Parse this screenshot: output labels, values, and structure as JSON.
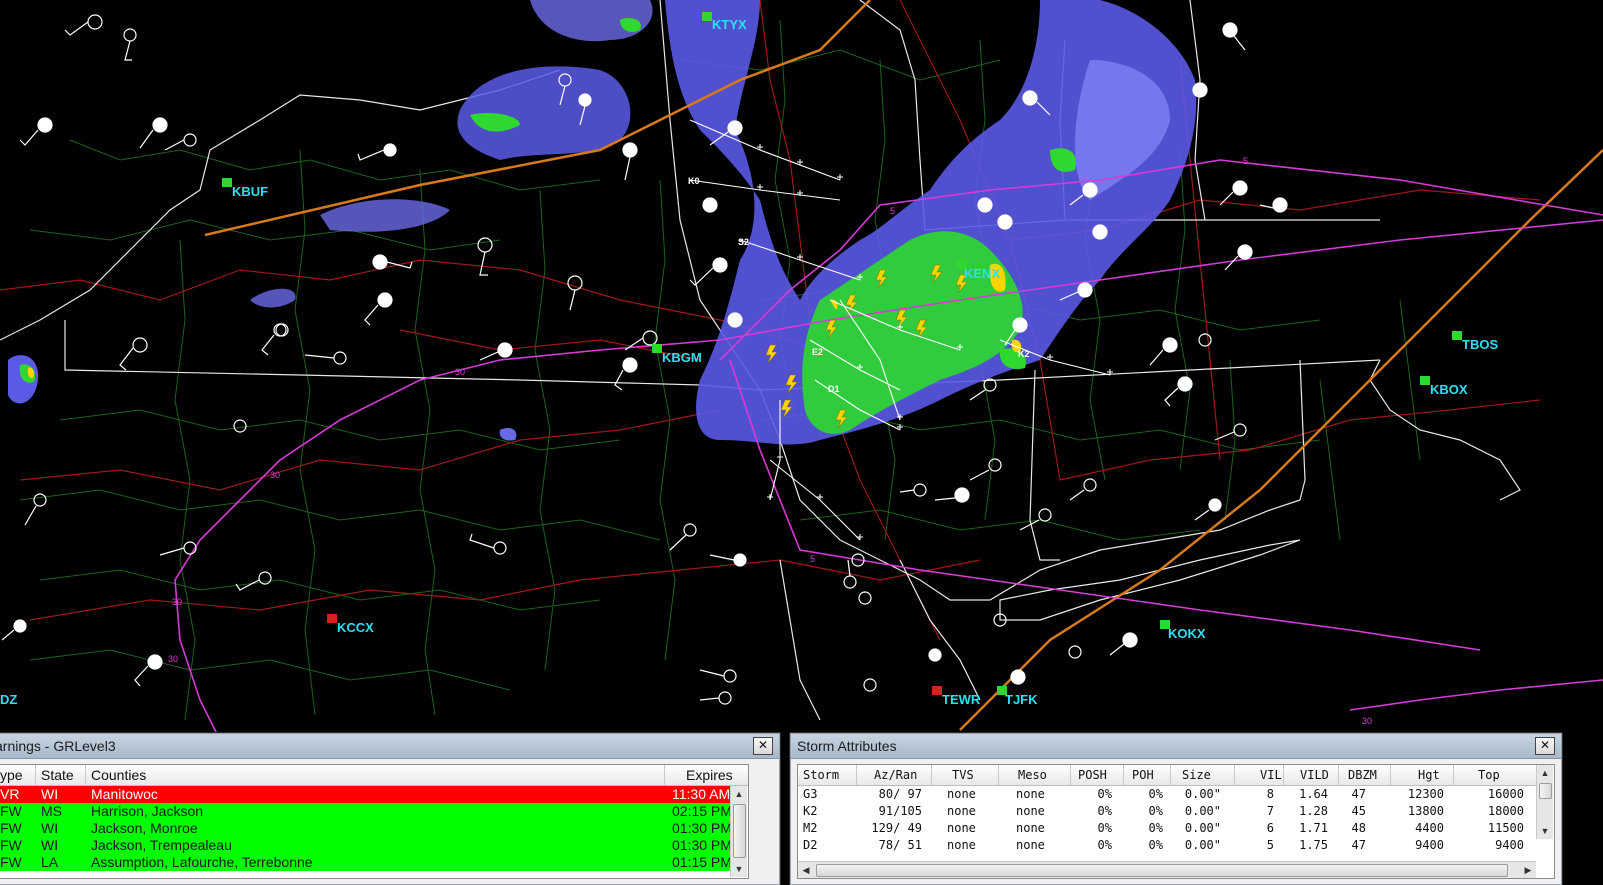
{
  "map": {
    "radars": [
      {
        "id": "KTYX"
      },
      {
        "id": "KBUF"
      },
      {
        "id": "KENX"
      },
      {
        "id": "KBGM"
      },
      {
        "id": "TBOS"
      },
      {
        "id": "KBOX"
      },
      {
        "id": "KCCX"
      },
      {
        "id": "KOKX"
      },
      {
        "id": "TEWR"
      },
      {
        "id": "TJFK"
      },
      {
        "id": "DZ"
      }
    ],
    "contour_labels": [
      "30",
      "30",
      "30",
      "30",
      "5",
      "5",
      "5",
      "30"
    ],
    "storm_ids": [
      "K0",
      "S2",
      "E2",
      "D1",
      "K2"
    ],
    "colors": {
      "state_border": "#ffffff",
      "county_line": "#1f7a1f",
      "highway": "#a01818",
      "front_line": "#d87a1a",
      "contour": "#d83ad8",
      "station_label": "#2ee0f0",
      "radar_light": "#5a5ae6",
      "radar_mid": "#2ed82e",
      "radar_heavy": "#ffd400"
    }
  },
  "warnings": {
    "title": "arnings - GRLevel3",
    "close_icon": "close-icon",
    "columns": [
      "ype",
      "State",
      "Counties",
      "Expires"
    ],
    "rows": [
      {
        "type": "VR",
        "state": "WI",
        "counties": "Manitowoc",
        "expires": "11:30 AM",
        "color": "#ff0000"
      },
      {
        "type": "FW",
        "state": "MS",
        "counties": "Harrison, Jackson",
        "expires": "02:15 PM",
        "color": "#00ff00"
      },
      {
        "type": "FW",
        "state": "WI",
        "counties": "Jackson, Monroe",
        "expires": "01:30 PM",
        "color": "#00ff00"
      },
      {
        "type": "FW",
        "state": "WI",
        "counties": "Jackson, Trempealeau",
        "expires": "01:30 PM",
        "color": "#00ff00"
      },
      {
        "type": "FW",
        "state": "LA",
        "counties": "Assumption, Lafourche, Terrebonne",
        "expires": "01:15 PM",
        "color": "#00ff00"
      }
    ]
  },
  "storm_attributes": {
    "title": "Storm Attributes",
    "columns": [
      "Storm",
      "Az/Ran",
      "TVS",
      "Meso",
      "POSH",
      "POH",
      "Size",
      "VIL",
      "VILD",
      "DBZM",
      "Hgt",
      "Top"
    ],
    "rows": [
      [
        "G3",
        "80/ 97",
        "none",
        "none",
        "0%",
        "0%",
        "0.00\"",
        "8",
        "1.64",
        "47",
        "12300",
        "16000"
      ],
      [
        "K2",
        "91/105",
        "none",
        "none",
        "0%",
        "0%",
        "0.00\"",
        "7",
        "1.28",
        "45",
        "13800",
        "18000"
      ],
      [
        "M2",
        "129/ 49",
        "none",
        "none",
        "0%",
        "0%",
        "0.00\"",
        "6",
        "1.71",
        "48",
        "4400",
        "11500"
      ],
      [
        "D2",
        "78/ 51",
        "none",
        "none",
        "0%",
        "0%",
        "0.00\"",
        "5",
        "1.75",
        "47",
        "9400",
        "9400"
      ]
    ]
  }
}
